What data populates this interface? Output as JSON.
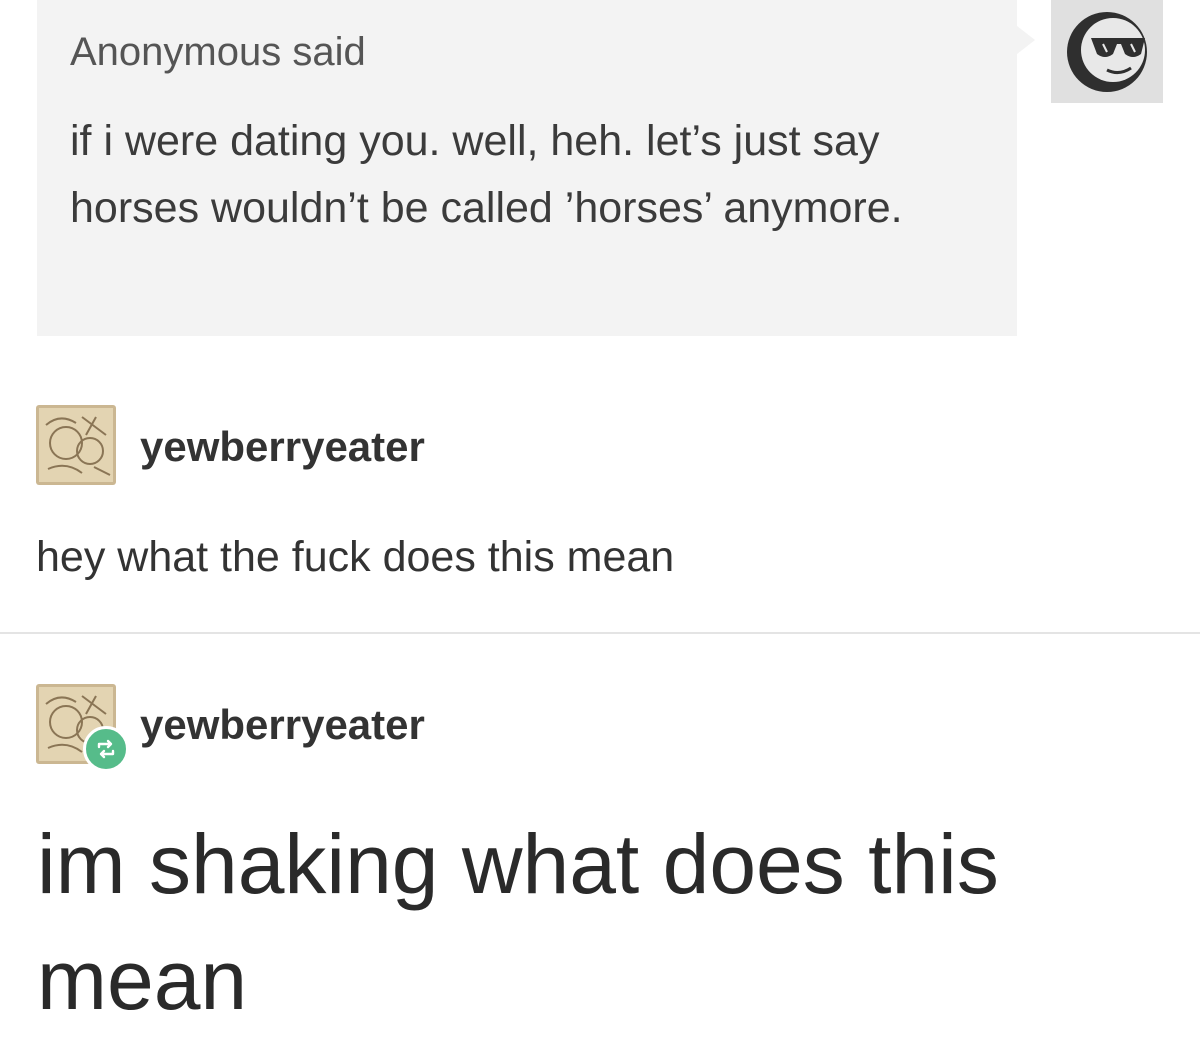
{
  "ask": {
    "asker_label": "Anonymous said",
    "question": "if i were dating you. well, heh. let’s just say horses wouldn’t be called ’horses’ anymore.",
    "avatar_icon": "sunglasses-face-icon"
  },
  "replies": [
    {
      "username": "yewberryeater",
      "text": "hey what the fuck does this mean",
      "avatar_icon": "sketch-avatar-icon"
    },
    {
      "username": "yewberryeater",
      "text": "im shaking what does this mean",
      "avatar_icon": "sketch-avatar-icon",
      "badge_icon": "reblog-icon"
    }
  ],
  "colors": {
    "ask_background": "#f3f3f3",
    "reblog_badge": "#56bc8a"
  }
}
